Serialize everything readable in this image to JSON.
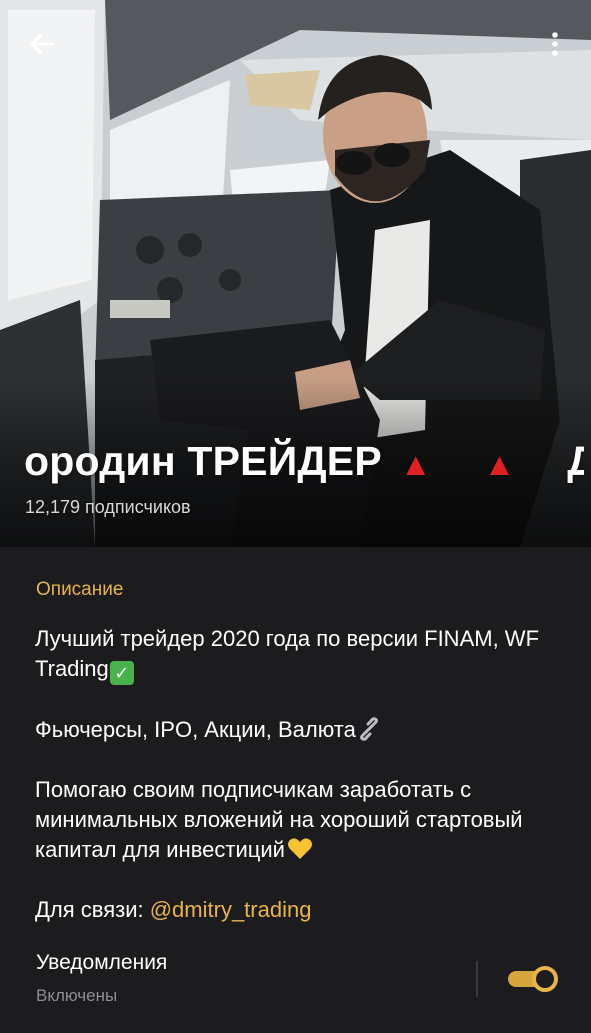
{
  "header": {
    "back_icon": "back-arrow-icon",
    "menu_icon": "more-vertical-icon",
    "channel_title": "ородин ТРЕЙДЕР",
    "title_flags": "▲▲",
    "title_trailing": "Д",
    "subscribers": "12,179 подписчиков"
  },
  "info": {
    "section_label": "Описание",
    "description": {
      "line1": "Лучший трейдер 2020 года по версии  FINAM, WF Trading",
      "line2": "Фьючерсы, IPO, Акции, Валюта",
      "line3": "Помогаю своим подписчикам заработать с минимальных вложений на хороший стартовый капитал для инвестиций",
      "contact_prefix": "Для связи: ",
      "contact_handle": "@dmitry_trading"
    },
    "emoji": [
      "check-mark-emoji",
      "link-emoji",
      "yellow-heart-emoji"
    ]
  },
  "notifications": {
    "title": "Уведомления",
    "status": "Включены",
    "enabled": true
  },
  "colors": {
    "accent": "#e8b445",
    "background": "#1c1c1e",
    "secondary_text": "#8d8d92",
    "flag_red": "#e02020"
  }
}
